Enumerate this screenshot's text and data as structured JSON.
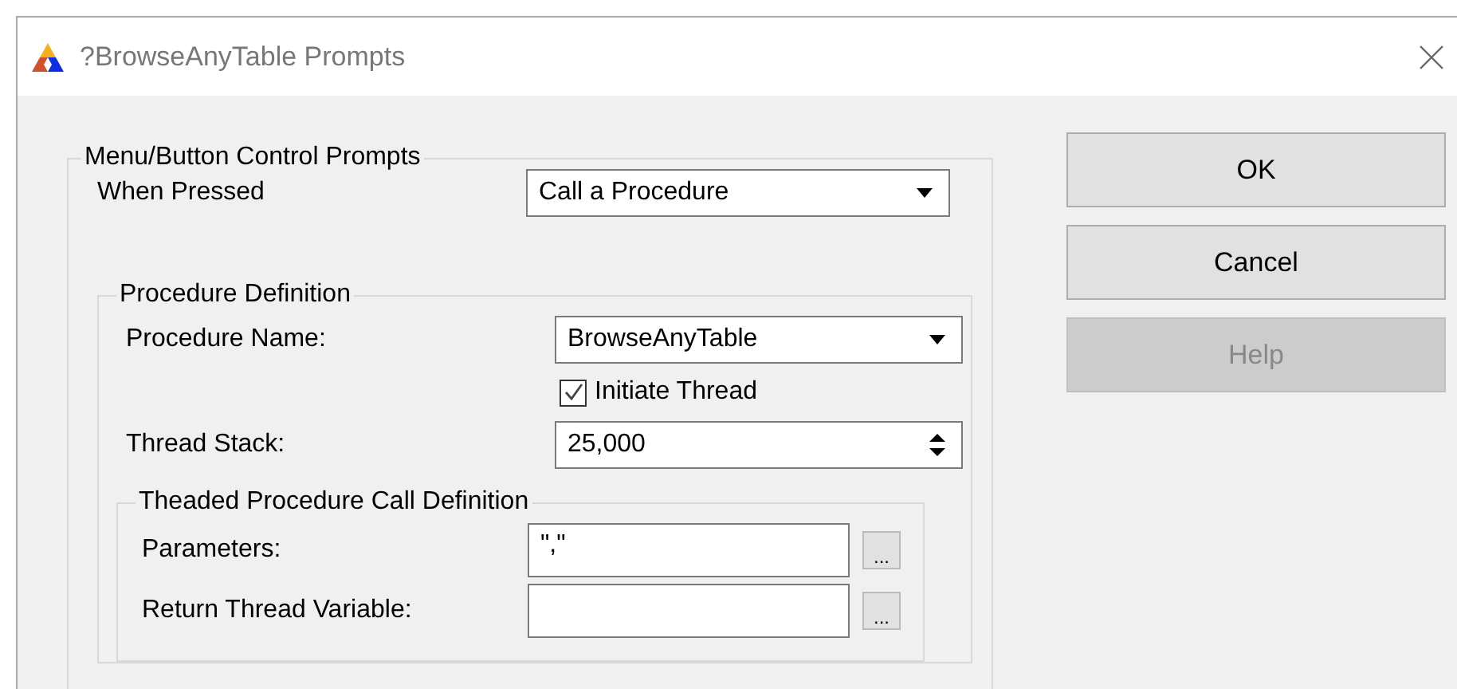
{
  "window": {
    "title": "?BrowseAnyTable Prompts"
  },
  "group": {
    "legend": "Menu/Button Control Prompts",
    "when_pressed": {
      "label": "When Pressed",
      "value": "Call a Procedure"
    },
    "procedure": {
      "legend": "Procedure Definition",
      "name": {
        "label": "Procedure Name:",
        "value": "BrowseAnyTable"
      },
      "initiate_thread": {
        "label": "Initiate Thread",
        "checked": true
      },
      "thread_stack": {
        "label": "Thread Stack:",
        "value": "25,000"
      },
      "call": {
        "legend": "Theaded Procedure Call Definition",
        "fields": [
          {
            "label": "Parameters:",
            "value": "\",\"",
            "button": "..."
          },
          {
            "label": "Return Thread Variable:",
            "button": "..."
          }
        ]
      }
    }
  },
  "buttons": [
    {
      "label": "OK",
      "disabled": false
    },
    {
      "label": "Cancel",
      "disabled": false
    },
    {
      "label": "Help",
      "disabled": true
    }
  ]
}
